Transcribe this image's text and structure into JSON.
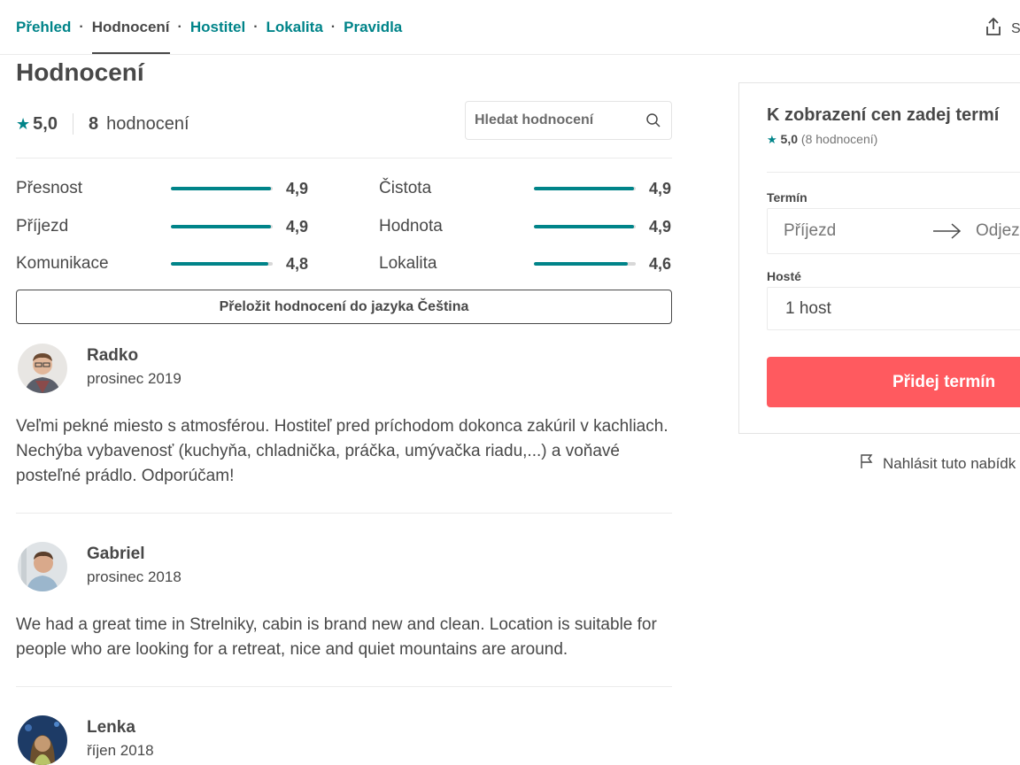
{
  "nav": {
    "items": [
      {
        "label": "Přehled",
        "active": false
      },
      {
        "label": "Hodnocení",
        "active": true
      },
      {
        "label": "Hostitel",
        "active": false
      },
      {
        "label": "Lokalita",
        "active": false
      },
      {
        "label": "Pravidla",
        "active": false
      }
    ],
    "share_label": "S"
  },
  "reviews_section": {
    "title": "Hodnocení",
    "overall_rating": "5,0",
    "review_count": "8",
    "review_count_label": "hodnocení",
    "search_placeholder": "Hledat hodnocení",
    "categories": [
      {
        "label": "Přesnost",
        "score": "4,9",
        "value": 4.9
      },
      {
        "label": "Čistota",
        "score": "4,9",
        "value": 4.9
      },
      {
        "label": "Příjezd",
        "score": "4,9",
        "value": 4.9
      },
      {
        "label": "Hodnota",
        "score": "4,9",
        "value": 4.9
      },
      {
        "label": "Komunikace",
        "score": "4,8",
        "value": 4.8
      },
      {
        "label": "Lokalita",
        "score": "4,6",
        "value": 4.6
      }
    ],
    "translate_label": "Přeložit hodnocení do jazyka Čeština",
    "reviews": [
      {
        "name": "Radko",
        "date": "prosinec 2019",
        "text": "Veľmi pekné miesto s atmosférou. Hostiteľ pred príchodom dokonca zakúril v kachliach. Nechýba vybavenosť (kuchyňa, chladnička, práčka, umývačka riadu,...) a voňavé posteľné prádlo. Odporúčam!"
      },
      {
        "name": "Gabriel",
        "date": "prosinec 2018",
        "text": "We had a great time in Strelniky, cabin is brand new and clean. Location is suitable for people who are looking for a retreat, nice and quiet mountains are around."
      },
      {
        "name": "Lenka",
        "date": "říjen 2018",
        "text": ""
      }
    ]
  },
  "booking": {
    "title": "K zobrazení cen zadej termí",
    "rating": "5,0",
    "rating_count": "(8 hodnocení)",
    "date_label": "Termín",
    "checkin_placeholder": "Příjezd",
    "checkout_placeholder": "Odjez",
    "guests_label": "Hosté",
    "guests_value": "1 host",
    "button_label": "Přidej termín",
    "report_label": "Nahlásit tuto nabídk"
  },
  "colors": {
    "accent": "#008489",
    "primary_button": "#ff5a5f",
    "text": "#484848"
  }
}
